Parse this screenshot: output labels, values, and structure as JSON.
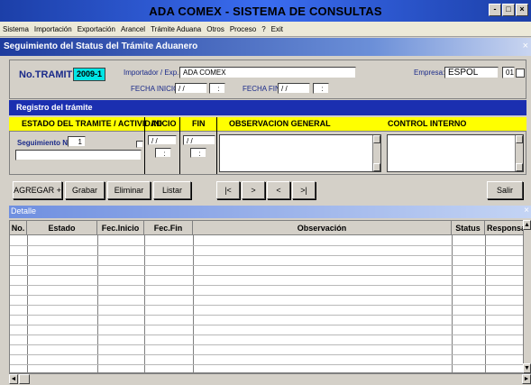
{
  "window": {
    "title": "ADA COMEX - SISTEMA DE CONSULTAS",
    "buttons": [
      "-",
      "□",
      "×"
    ]
  },
  "menu": [
    "Sistema",
    "Importación",
    "Exportación",
    "Arancel",
    "Trámite Aduana",
    "Otros",
    "Proceso",
    "?",
    "Exit"
  ],
  "form": {
    "title": "Seguimiento del Status del Trámite Aduanero",
    "close": "×"
  },
  "header": {
    "tramite_label": "No.TRAMITE:",
    "tramite_value": "2009-1",
    "importador_label": "Importador / Exp.:",
    "importador_value": "ADA COMEX",
    "empresa_label": "Empresa:",
    "empresa_value": "ESPOL",
    "empresa_code": "01",
    "fecha_inicio_label": "FECHA INICIO:",
    "fecha_inicio_date": "/ /",
    "fecha_inicio_time": ":",
    "fecha_fin_label": "FECHA FIN:",
    "fecha_fin_date": "/ /",
    "fecha_fin_time": ":"
  },
  "registro": {
    "title": "Registro del trámite",
    "col_estado": "ESTADO DEL TRAMITE / ACTIVIDAD",
    "col_inicio": "INICIO",
    "col_fin": "FIN",
    "col_observacion": "OBSERVACION GENERAL",
    "col_control": "CONTROL INTERNO",
    "seguimiento_label": "Seguimiento No:",
    "seguimiento_value": "1",
    "inicio_date": "/ /",
    "inicio_time": ":",
    "fin_date": "/ /",
    "fin_time": ":"
  },
  "toolbar": {
    "agregar": "AGREGAR +",
    "grabar": "Grabar",
    "eliminar": "Eliminar",
    "listar": "Listar",
    "first": "|<",
    "next": ">",
    "prev": "<",
    "last": ">|",
    "salir": "Salir"
  },
  "detalle": {
    "title": "Detalle",
    "columns": [
      "No.",
      "Estado",
      "Fec.Inicio",
      "Fec.Fin",
      "Observación",
      "Status",
      "Responsable"
    ]
  }
}
